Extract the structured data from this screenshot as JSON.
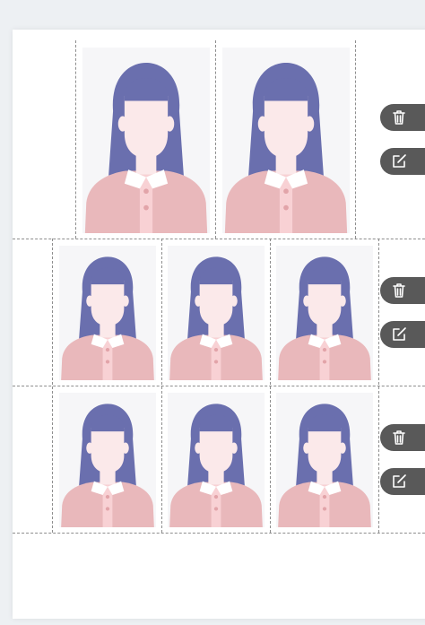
{
  "page": {
    "background": "#edf0f3",
    "sheet_color": "#ffffff",
    "cut_line_color": "#8e8e8e"
  },
  "avatar": {
    "photo_background": "#f6f6f8",
    "hair_color": "#6a6fae",
    "skin_color": "#fbe9ea",
    "shirt_color": "#e9b8bb",
    "collar_color": "#ffffff",
    "placket_color": "#f8d1d4",
    "button_color": "#e2a4a9"
  },
  "rows": [
    {
      "name": "row-1",
      "photo_count": 2,
      "icons": [
        "trash-icon",
        "edit-icon"
      ]
    },
    {
      "name": "row-2",
      "photo_count": 3,
      "icons": [
        "trash-icon",
        "edit-icon"
      ]
    },
    {
      "name": "row-3",
      "photo_count": 3,
      "icons": [
        "trash-icon",
        "edit-icon"
      ]
    }
  ],
  "tool_button_color": "#595959"
}
